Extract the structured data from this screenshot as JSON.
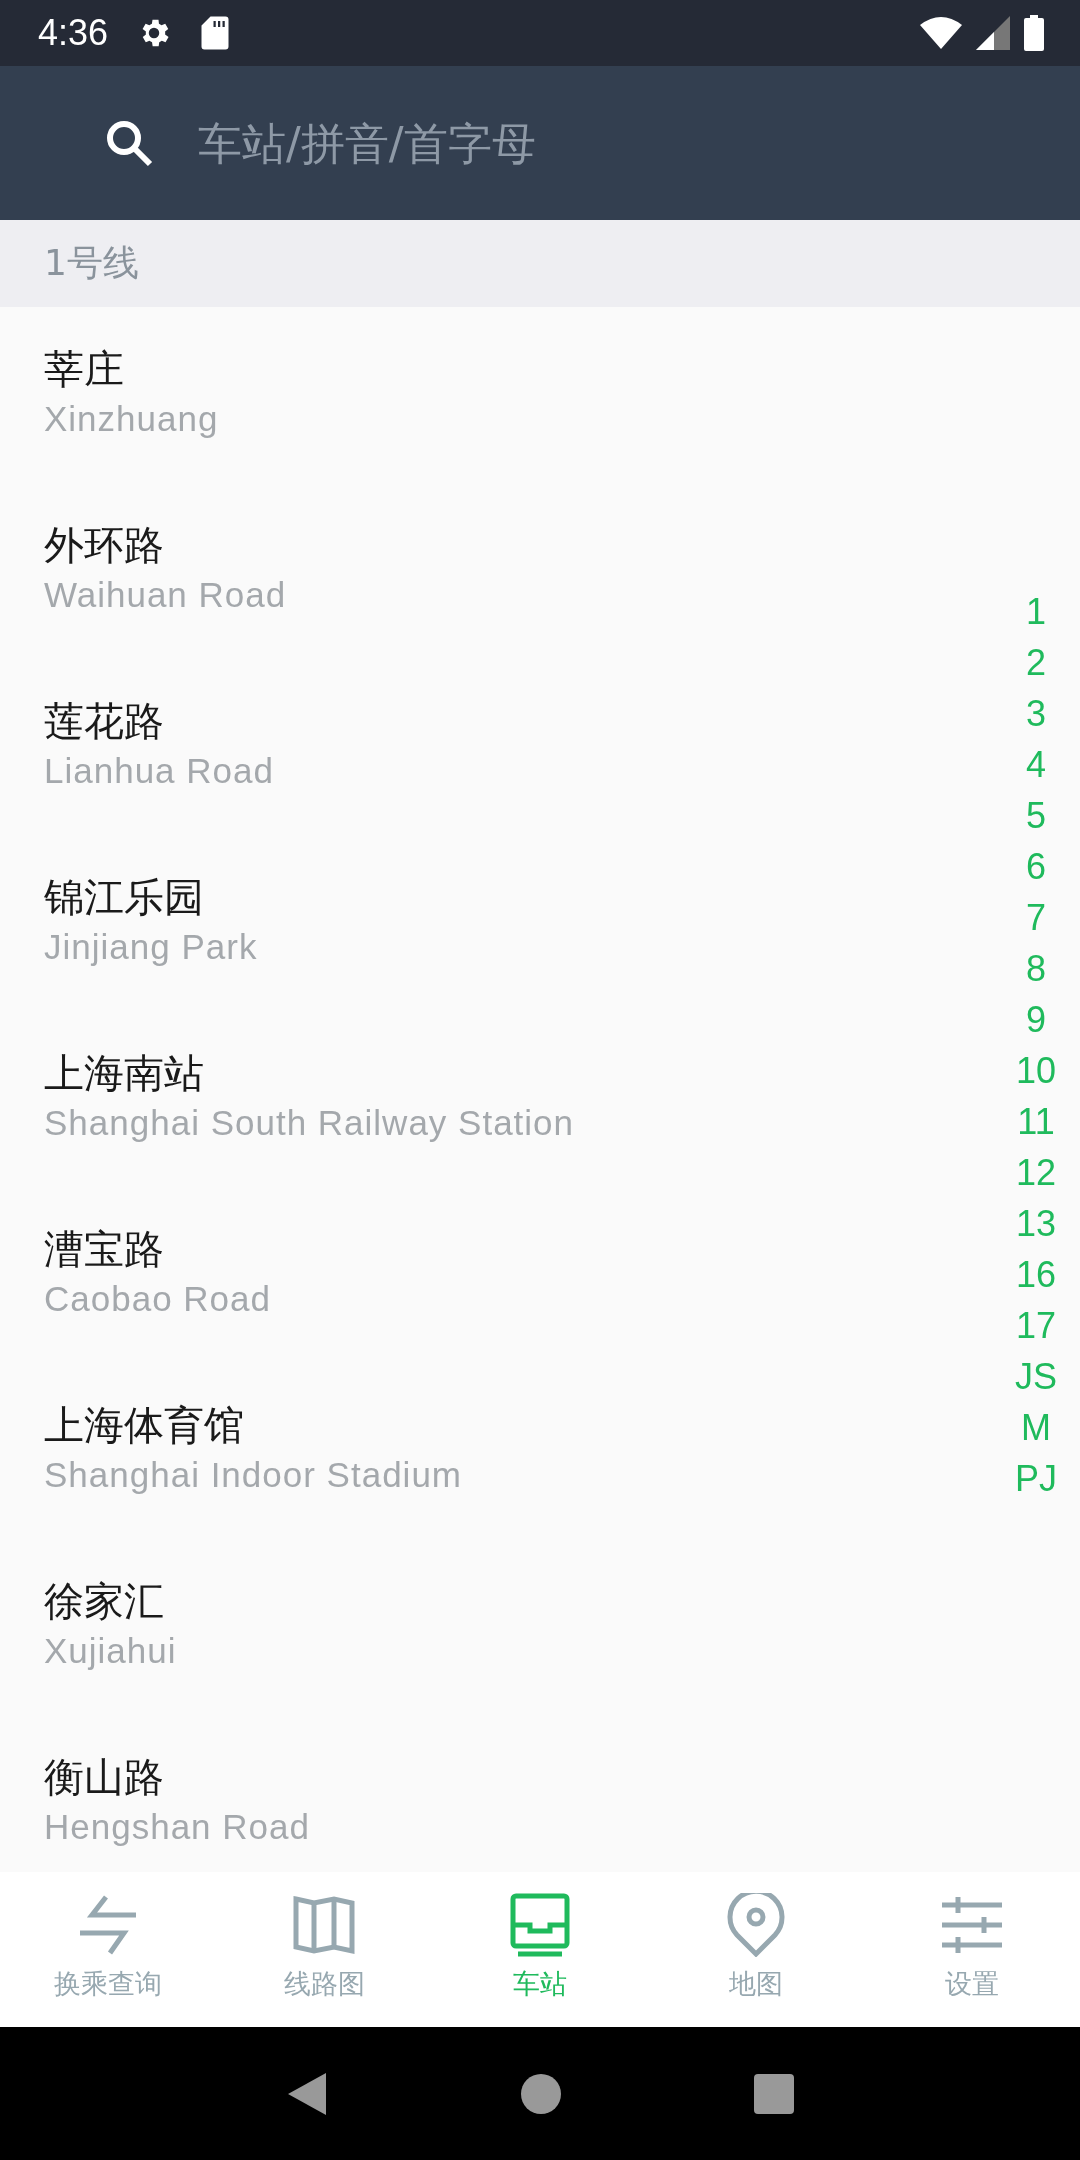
{
  "status_bar": {
    "time": "4:36"
  },
  "search": {
    "placeholder": "车站/拼音/首字母"
  },
  "section": {
    "title": "1号线"
  },
  "stations": [
    {
      "name": "莘庄",
      "name_en": "Xinzhuang"
    },
    {
      "name": "外环路",
      "name_en": "Waihuan Road"
    },
    {
      "name": "莲花路",
      "name_en": "Lianhua Road"
    },
    {
      "name": "锦江乐园",
      "name_en": "Jinjiang Park"
    },
    {
      "name": "上海南站",
      "name_en": "Shanghai South Railway Station"
    },
    {
      "name": "漕宝路",
      "name_en": "Caobao Road"
    },
    {
      "name": "上海体育馆",
      "name_en": "Shanghai Indoor Stadium"
    },
    {
      "name": "徐家汇",
      "name_en": "Xujiahui"
    },
    {
      "name": "衡山路",
      "name_en": "Hengshan Road"
    }
  ],
  "line_index": [
    "1",
    "2",
    "3",
    "4",
    "5",
    "6",
    "7",
    "8",
    "9",
    "10",
    "11",
    "12",
    "13",
    "16",
    "17",
    "JS",
    "M",
    "PJ"
  ],
  "tabs": [
    {
      "label": "换乘查询",
      "kind": "transfer",
      "selected": false
    },
    {
      "label": "线路图",
      "kind": "map-book",
      "selected": false
    },
    {
      "label": "车站",
      "kind": "station",
      "selected": true
    },
    {
      "label": "地图",
      "kind": "pin",
      "selected": false
    },
    {
      "label": "设置",
      "kind": "sliders",
      "selected": false
    }
  ]
}
